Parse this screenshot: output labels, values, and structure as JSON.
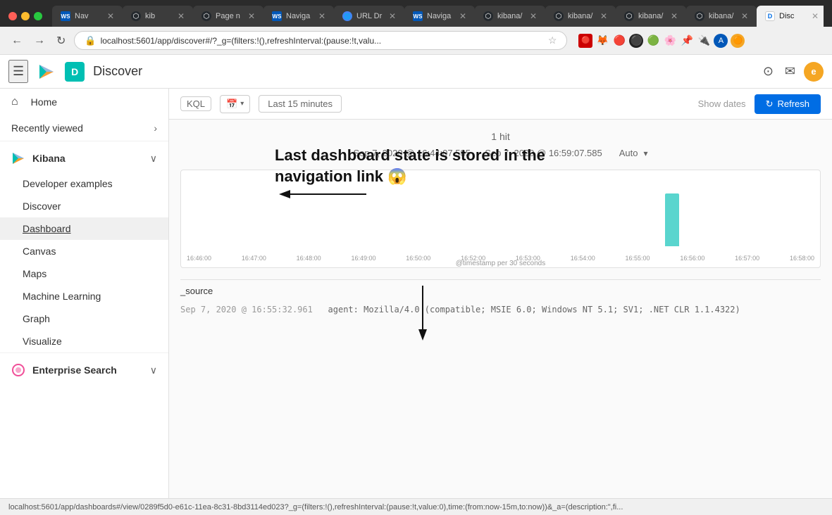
{
  "browser": {
    "tabs": [
      {
        "id": "t1",
        "favicon_type": "ws",
        "favicon_text": "WS",
        "label": "Nav",
        "active": false,
        "closeable": true
      },
      {
        "id": "t2",
        "favicon_type": "gh",
        "favicon_text": "⬡",
        "label": "kib",
        "active": false,
        "closeable": true
      },
      {
        "id": "t3",
        "favicon_type": "gh",
        "favicon_text": "⬡",
        "label": "Page n",
        "active": false,
        "closeable": true
      },
      {
        "id": "t4",
        "favicon_type": "ws",
        "favicon_text": "WS",
        "label": "Naviga",
        "active": false,
        "closeable": true
      },
      {
        "id": "t5",
        "favicon_type": "url",
        "favicon_text": "🌐",
        "label": "URL Dr",
        "active": false,
        "closeable": true
      },
      {
        "id": "t6",
        "favicon_type": "ws",
        "favicon_text": "WS",
        "label": "Naviga",
        "active": false,
        "closeable": true
      },
      {
        "id": "t7",
        "favicon_type": "gh",
        "favicon_text": "⬡",
        "label": "kibana/",
        "active": false,
        "closeable": true
      },
      {
        "id": "t8",
        "favicon_type": "gh",
        "favicon_text": "⬡",
        "label": "kibana/",
        "active": false,
        "closeable": true
      },
      {
        "id": "t9",
        "favicon_type": "gh",
        "favicon_text": "⬡",
        "label": "kibana/",
        "active": false,
        "closeable": true
      },
      {
        "id": "t10",
        "favicon_type": "gh",
        "favicon_text": "⬡",
        "label": "kibana/",
        "active": false,
        "closeable": true
      },
      {
        "id": "t11",
        "favicon_type": "dis",
        "favicon_text": "D",
        "label": "Disc",
        "active": true,
        "closeable": true
      }
    ],
    "url": "localhost:5601/app/discover#/?_g=(filters:!(),refreshInterval:(pause:!t,valu...",
    "extensions": [
      "🔴",
      "🦊",
      "🔴",
      "⚫",
      "🟢",
      "🌸",
      "📌",
      "🔌",
      "👤",
      "🟠"
    ]
  },
  "app": {
    "title": "Discover",
    "avatar_letter": "D",
    "user_letter": "e"
  },
  "sidebar": {
    "home_label": "Home",
    "recently_viewed_label": "Recently viewed",
    "groups": [
      {
        "id": "kibana",
        "logo": "kibana",
        "title": "Kibana",
        "expanded": true,
        "items": [
          {
            "id": "developer-examples",
            "label": "Developer examples"
          },
          {
            "id": "discover",
            "label": "Discover"
          },
          {
            "id": "dashboard",
            "label": "Dashboard",
            "active": false
          },
          {
            "id": "canvas",
            "label": "Canvas"
          },
          {
            "id": "maps",
            "label": "Maps"
          },
          {
            "id": "machine-learning",
            "label": "Machine Learning"
          },
          {
            "id": "graph",
            "label": "Graph"
          },
          {
            "id": "visualize",
            "label": "Visualize"
          }
        ]
      },
      {
        "id": "enterprise-search",
        "logo": "enterprise",
        "title": "Enterprise Search",
        "expanded": false,
        "items": []
      }
    ]
  },
  "toolbar": {
    "kql_label": "KQL",
    "time_label": "Last 15 minutes",
    "show_dates_label": "Show dates",
    "refresh_label": "Refresh"
  },
  "content": {
    "hit_count": "1 hit",
    "time_range_start": "Sep 7, 2020 @ 16:44:07.585",
    "time_range_end": "Sep 7, 2020 @ 16:59:07.585",
    "auto_label": "Auto",
    "chart_times": [
      "16:46:00",
      "16:47:00",
      "16:48:00",
      "16:49:00",
      "16:50:00",
      "16:52:00",
      "16:53:00",
      "16:54:00",
      "16:55:00",
      "16:56:00",
      "16:57:00",
      "16:58:00"
    ],
    "x_axis_label": "@timestamp per 30 seconds",
    "source_label": "_source",
    "log_timestamp": "Sep 7, 2020 @ 16:55:32.961",
    "log_entry": "agent: Mozilla/4.0 (compatible; MSIE 6.0; Windows NT 5.1; SV1; .NET CLR 1.1.4322)"
  },
  "annotation": {
    "text": "Last dashboard state is stored in the navigation link 😱"
  },
  "status_bar": {
    "url": "localhost:5601/app/dashboards#/view/0289f5d0-e61c-11ea-8c31-8bd3114ed023?_g=(filters:!(),refreshInterval:(pause:!t,value:0),time:(from:now-15m,to:now))&_a=(description:\",fi..."
  }
}
